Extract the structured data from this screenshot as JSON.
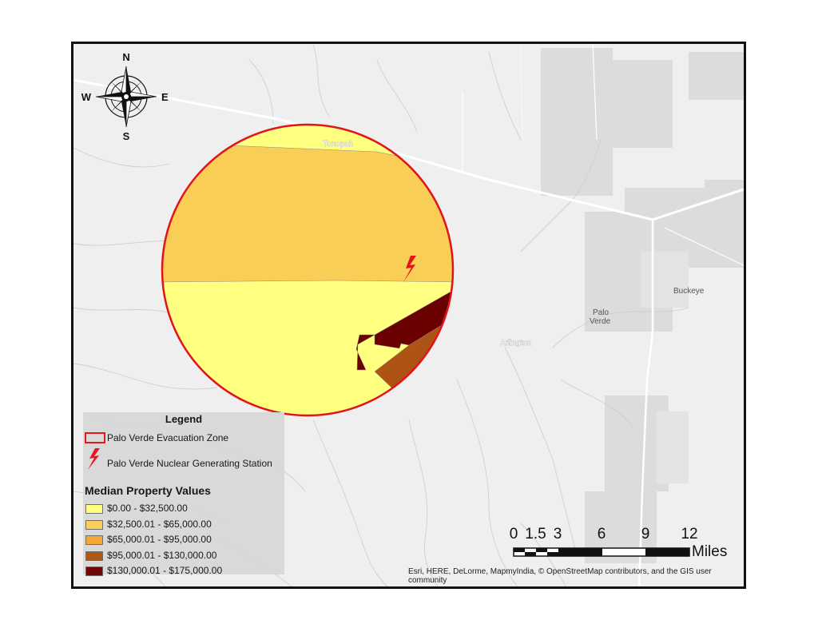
{
  "map": {
    "place_labels": {
      "tonopah": "Tonopah",
      "buckeye": "Buckeye",
      "palo_verde_line1": "Palo",
      "palo_verde_line2": "Verde",
      "arlington": "Arlington"
    },
    "basemap_colors": {
      "background": "#efefef",
      "roads": "#ffffff",
      "landuse": "#dcdcdc",
      "drainage": "#d2d2d2"
    }
  },
  "north_arrow": {
    "n": "N",
    "s": "S",
    "e": "E",
    "w": "W"
  },
  "legend": {
    "title": "Legend",
    "evacuation_zone_label": "Palo Verde Evacuation Zone",
    "station_label": "Palo Verde Nuclear Generating Station",
    "median_title": "Median Property Values",
    "classes": [
      {
        "label": "$0.00 - $32,500.00",
        "color": "#ffff80"
      },
      {
        "label": "$32,500.01 - $65,000.00",
        "color": "#f9ce57"
      },
      {
        "label": "$65,000.01 - $95,000.00",
        "color": "#f2a634"
      },
      {
        "label": "$95,000.01 - $130,000.00",
        "color": "#ad5313"
      },
      {
        "label": "$130,000.01 - $175,000.00",
        "color": "#6b0000"
      }
    ],
    "zone_outline_color": "#e3131b",
    "station_color": "#e3131b"
  },
  "scale_bar": {
    "ticks": [
      "0",
      "1.5",
      "3",
      "6",
      "9",
      "12"
    ],
    "unit": "Miles"
  },
  "attribution": "Esri, HERE, DeLorme, MapmyIndia, © OpenStreetMap contributors, and the GIS user community"
}
